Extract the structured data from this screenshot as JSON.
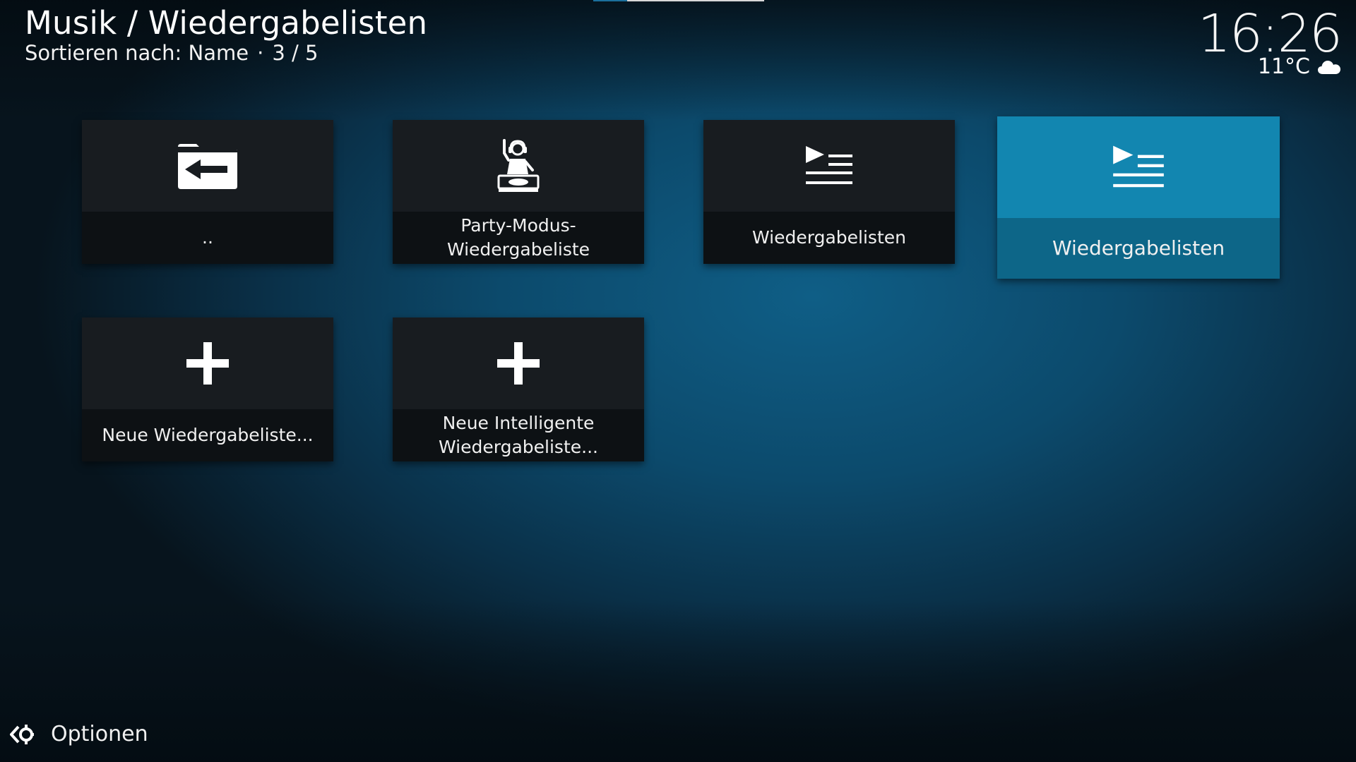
{
  "header": {
    "title": "Musik / Wiedergabelisten",
    "sort_label": "Sortieren nach: Name",
    "separator": "·",
    "position": "3 / 5"
  },
  "clock": {
    "time": "16:26",
    "temperature": "11°C",
    "weather_icon": "cloud-icon"
  },
  "tiles": [
    {
      "icon": "folder-back-icon",
      "label": ".."
    },
    {
      "icon": "dj-party-icon",
      "label": "Party-Modus-Wiedergabeliste"
    },
    {
      "icon": "playlist-icon",
      "label": "Wiedergabelisten"
    },
    {
      "icon": "playlist-icon",
      "label": "Wiedergabelisten",
      "focused": true
    },
    {
      "icon": "plus-icon",
      "label": "Neue Wiedergabeliste..."
    },
    {
      "icon": "plus-icon",
      "label_line1": "Neue Intelligente",
      "label_line2": "Wiedergabeliste..."
    }
  ],
  "footer": {
    "options_label": "Optionen",
    "options_icon": "options-gear-icon"
  },
  "colors": {
    "focus_top": "#1286b0",
    "focus_bottom": "#0d6688",
    "tile_top": "#181c20",
    "tile_bottom": "#0d1114"
  }
}
